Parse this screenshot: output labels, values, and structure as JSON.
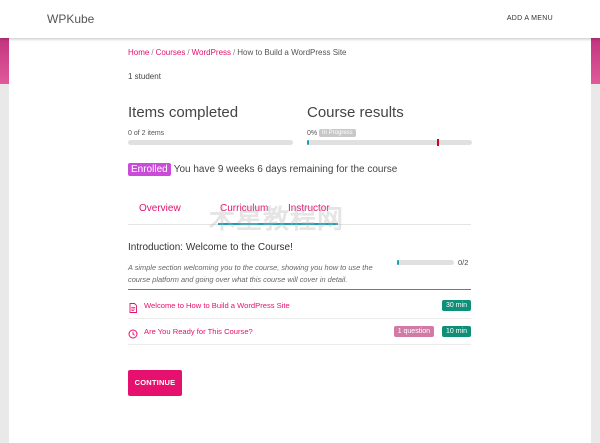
{
  "header": {
    "logo": "WPKube",
    "menu_label": "ADD A MENU"
  },
  "breadcrumb": {
    "items": [
      "Home",
      "Courses",
      "WordPress"
    ],
    "current": "How to Build a WordPress Site",
    "separator": "/"
  },
  "course": {
    "students": "1 student",
    "items_completed": {
      "heading": "Items completed",
      "count_text": "0 of 2 items",
      "progress": 0
    },
    "course_results": {
      "heading": "Course results",
      "percent_text": "0%",
      "status": "In Progress",
      "progress": 0.01
    },
    "enrollment": {
      "badge": "Enrolled",
      "remaining_text": "You have 9 weeks 6 days remaining for the course"
    }
  },
  "tabs": [
    "Overview",
    "Curriculum",
    "Instructor"
  ],
  "watermark": "木星教程网",
  "curriculum": {
    "section_title": "Introduction: Welcome to the Course!",
    "section_desc": "A simple section welcoming you to the course, showing you how to use the course platform and going over what this course will cover in detail.",
    "section_progress_text": "0/2",
    "section_progress": 0,
    "lessons": [
      {
        "title": "Welcome to How to Build a WordPress Site",
        "icon": "document-icon",
        "duration": "30 min"
      },
      {
        "title": "Are You Ready for This Course?",
        "icon": "quiz-icon",
        "questions": "1 question",
        "duration": "10 min"
      }
    ]
  },
  "actions": {
    "continue_label": "CONTINUE"
  },
  "colors": {
    "accent": "#e6106f",
    "teal": "#1b9fb0",
    "enrolled": "#c94bd8",
    "duration_badge": "#0e8f77",
    "question_badge": "#d27aa6"
  }
}
